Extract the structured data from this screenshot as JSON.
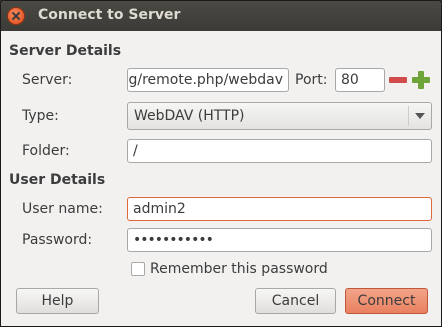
{
  "window": {
    "title": "Connect to Server"
  },
  "server_details": {
    "header": "Server Details",
    "server_label": "Server:",
    "server_value": "g/remote.php/webdav",
    "port_label": "Port:",
    "port_value": "80",
    "type_label": "Type:",
    "type_value": "WebDAV (HTTP)",
    "folder_label": "Folder:",
    "folder_value": "/"
  },
  "user_details": {
    "header": "User Details",
    "username_label": "User name:",
    "username_value": "admin2",
    "password_label": "Password:",
    "password_value": "•••••••••••",
    "remember_label": "Remember this password",
    "remember_checked": false
  },
  "buttons": {
    "help": "Help",
    "cancel": "Cancel",
    "connect": "Connect"
  },
  "icons": {
    "close": "close-icon",
    "port_decrement": "minus-icon",
    "port_increment": "plus-icon",
    "type_dropdown": "chevron-down-icon"
  },
  "colors": {
    "accent": "#e8805f",
    "titlebar": "#3c3b37",
    "focus_border": "#e0693c"
  }
}
